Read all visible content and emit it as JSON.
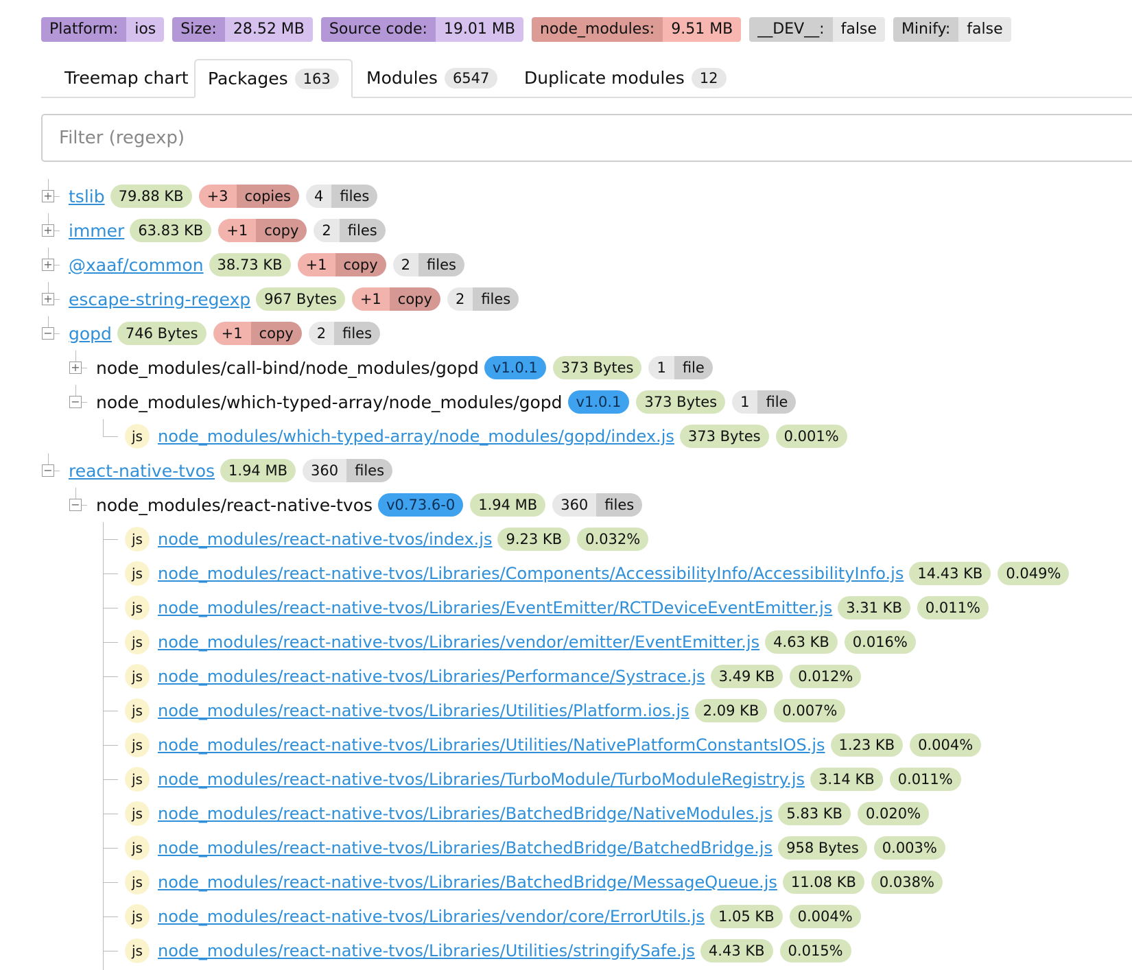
{
  "info": {
    "platform": {
      "k": "Platform:",
      "v": "ios"
    },
    "size": {
      "k": "Size:",
      "v": "28.52 MB"
    },
    "source": {
      "k": "Source code:",
      "v": "19.01 MB"
    },
    "nodemods": {
      "k": "node_modules:",
      "v": "9.51 MB"
    },
    "dev": {
      "k": "__DEV__:",
      "v": "false"
    },
    "minify": {
      "k": "Minify:",
      "v": "false"
    }
  },
  "tabs": [
    {
      "label": "Treemap chart",
      "count": ""
    },
    {
      "label": "Packages",
      "count": "163"
    },
    {
      "label": "Modules",
      "count": "6547"
    },
    {
      "label": "Duplicate modules",
      "count": "12"
    }
  ],
  "filter": {
    "placeholder": "Filter (regexp)"
  },
  "packages": [
    {
      "name": "tslib",
      "size": "79.88 KB",
      "copies_n": "+3",
      "copies_l": "copies",
      "files_n": "4",
      "files_l": "files"
    },
    {
      "name": "immer",
      "size": "63.83 KB",
      "copies_n": "+1",
      "copies_l": "copy",
      "files_n": "2",
      "files_l": "files"
    },
    {
      "name": "@xaaf/common",
      "size": "38.73 KB",
      "copies_n": "+1",
      "copies_l": "copy",
      "files_n": "2",
      "files_l": "files"
    },
    {
      "name": "escape-string-regexp",
      "size": "967 Bytes",
      "copies_n": "+1",
      "copies_l": "copy",
      "files_n": "2",
      "files_l": "files"
    },
    {
      "name": "gopd",
      "size": "746 Bytes",
      "copies_n": "+1",
      "copies_l": "copy",
      "files_n": "2",
      "files_l": "files"
    }
  ],
  "gopd_children": [
    {
      "path": "node_modules/call-bind/node_modules/gopd",
      "version": "v1.0.1",
      "size": "373 Bytes",
      "files_n": "1",
      "files_l": "file"
    },
    {
      "path": "node_modules/which-typed-array/node_modules/gopd",
      "version": "v1.0.1",
      "size": "373 Bytes",
      "files_n": "1",
      "files_l": "file"
    }
  ],
  "gopd_file": {
    "ext": "js",
    "path": "node_modules/which-typed-array/node_modules/gopd/index.js",
    "size": "373 Bytes",
    "pct": "0.001%"
  },
  "rntvos": {
    "name": "react-native-tvos",
    "size": "1.94 MB",
    "files_n": "360",
    "files_l": "files"
  },
  "rntvos_child": {
    "path": "node_modules/react-native-tvos",
    "version": "v0.73.6-0",
    "size": "1.94 MB",
    "files_n": "360",
    "files_l": "files"
  },
  "files": [
    {
      "ext": "js",
      "path": "node_modules/react-native-tvos/index.js",
      "size": "9.23 KB",
      "pct": "0.032%"
    },
    {
      "ext": "js",
      "path": "node_modules/react-native-tvos/Libraries/Components/AccessibilityInfo/AccessibilityInfo.js",
      "size": "14.43 KB",
      "pct": "0.049%"
    },
    {
      "ext": "js",
      "path": "node_modules/react-native-tvos/Libraries/EventEmitter/RCTDeviceEventEmitter.js",
      "size": "3.31 KB",
      "pct": "0.011%"
    },
    {
      "ext": "js",
      "path": "node_modules/react-native-tvos/Libraries/vendor/emitter/EventEmitter.js",
      "size": "4.63 KB",
      "pct": "0.016%"
    },
    {
      "ext": "js",
      "path": "node_modules/react-native-tvos/Libraries/Performance/Systrace.js",
      "size": "3.49 KB",
      "pct": "0.012%"
    },
    {
      "ext": "js",
      "path": "node_modules/react-native-tvos/Libraries/Utilities/Platform.ios.js",
      "size": "2.09 KB",
      "pct": "0.007%"
    },
    {
      "ext": "js",
      "path": "node_modules/react-native-tvos/Libraries/Utilities/NativePlatformConstantsIOS.js",
      "size": "1.23 KB",
      "pct": "0.004%"
    },
    {
      "ext": "js",
      "path": "node_modules/react-native-tvos/Libraries/TurboModule/TurboModuleRegistry.js",
      "size": "3.14 KB",
      "pct": "0.011%"
    },
    {
      "ext": "js",
      "path": "node_modules/react-native-tvos/Libraries/BatchedBridge/NativeModules.js",
      "size": "5.83 KB",
      "pct": "0.020%"
    },
    {
      "ext": "js",
      "path": "node_modules/react-native-tvos/Libraries/BatchedBridge/BatchedBridge.js",
      "size": "958 Bytes",
      "pct": "0.003%"
    },
    {
      "ext": "js",
      "path": "node_modules/react-native-tvos/Libraries/BatchedBridge/MessageQueue.js",
      "size": "11.08 KB",
      "pct": "0.038%"
    },
    {
      "ext": "js",
      "path": "node_modules/react-native-tvos/Libraries/vendor/core/ErrorUtils.js",
      "size": "1.05 KB",
      "pct": "0.004%"
    },
    {
      "ext": "js",
      "path": "node_modules/react-native-tvos/Libraries/Utilities/stringifySafe.js",
      "size": "4.43 KB",
      "pct": "0.015%"
    }
  ]
}
